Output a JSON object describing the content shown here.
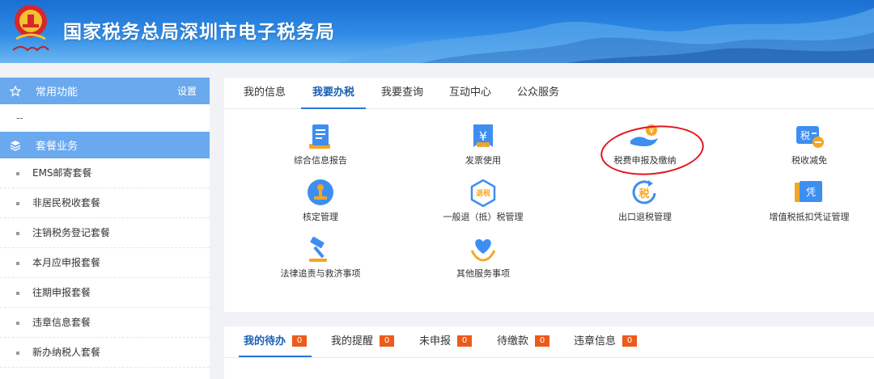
{
  "header": {
    "title": "国家税务总局深圳市电子税务局",
    "emblem_icon": "tax-emblem-icon",
    "colors": {
      "bar": "#2f8ce6",
      "title": "#ffffff"
    }
  },
  "sidebar": {
    "common": {
      "label": "常用功能",
      "setting_label": "设置",
      "icon": "star-icon",
      "empty_text": "--"
    },
    "packages": {
      "label": "套餐业务",
      "icon": "layers-icon"
    },
    "items": [
      {
        "label": "EMS邮寄套餐"
      },
      {
        "label": "非居民税收套餐"
      },
      {
        "label": "注销税务登记套餐"
      },
      {
        "label": "本月应申报套餐"
      },
      {
        "label": "往期申报套餐"
      },
      {
        "label": "违章信息套餐"
      },
      {
        "label": "新办纳税人套餐"
      }
    ]
  },
  "main_tabs": [
    {
      "label": "我的信息"
    },
    {
      "label": "我要办税",
      "active": true
    },
    {
      "label": "我要查询"
    },
    {
      "label": "互动中心"
    },
    {
      "label": "公众服务"
    }
  ],
  "functions": [
    {
      "label": "综合信息报告",
      "icon": "report-icon"
    },
    {
      "label": "发票使用",
      "icon": "invoice-icon"
    },
    {
      "label": "税费申报及缴纳",
      "icon": "tax-payment-hand-icon",
      "highlighted": true
    },
    {
      "label": "税收减免",
      "icon": "tax-relief-icon"
    },
    {
      "label": "核定管理",
      "icon": "stamp-icon"
    },
    {
      "label": "一般退（抵）税管理",
      "icon": "tax-refund-icon"
    },
    {
      "label": "出口退税管理",
      "icon": "export-refund-icon"
    },
    {
      "label": "增值税抵扣凭证管理",
      "icon": "voucher-icon"
    },
    {
      "label": "法律追责与救济事项",
      "icon": "gavel-icon"
    },
    {
      "label": "其他服务事项",
      "icon": "heart-hands-icon"
    }
  ],
  "icon_glyphs": {
    "invoice": "¥",
    "tax_relief": "税",
    "tax_refund": "退税",
    "export_refund": "税",
    "voucher": "凭",
    "payment_coin": "¥"
  },
  "bottom_tabs": [
    {
      "label": "我的待办",
      "count": "0",
      "active": true
    },
    {
      "label": "我的提醒",
      "count": "0"
    },
    {
      "label": "未申报",
      "count": "0"
    },
    {
      "label": "待缴款",
      "count": "0"
    },
    {
      "label": "违章信息",
      "count": "0"
    }
  ],
  "colors": {
    "accent": "#2b74d8",
    "sidebar_header": "#6aa9ee",
    "badge": "#ec5b1c",
    "highlight_circle": "#e3161d",
    "icon_orange": "#f5a623",
    "icon_blue": "#3d8ef0"
  }
}
